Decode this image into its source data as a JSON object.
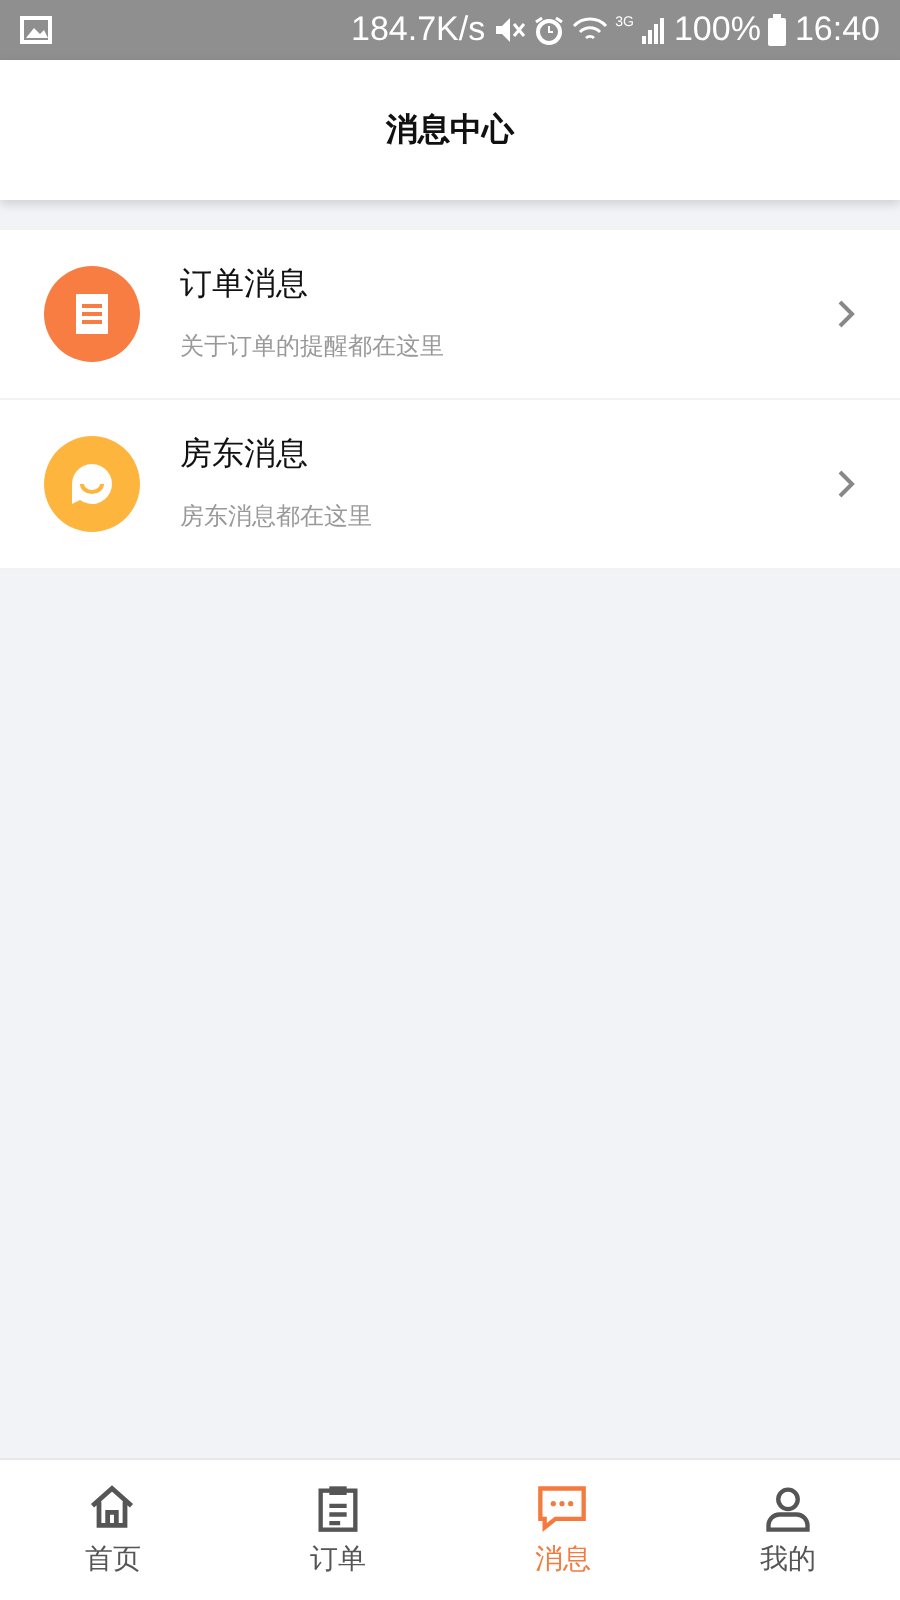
{
  "status_bar": {
    "speed": "184.7K/s",
    "network": "3G",
    "battery": "100%",
    "time": "16:40"
  },
  "header": {
    "title": "消息中心"
  },
  "messages": [
    {
      "kind": "order",
      "title": "订单消息",
      "subtitle": "关于订单的提醒都在这里",
      "color": "#f77d43"
    },
    {
      "kind": "landlord",
      "title": "房东消息",
      "subtitle": "房东消息都在这里",
      "color": "#fdb53e"
    }
  ],
  "tabs": [
    {
      "kind": "home",
      "label": "首页",
      "selected": false
    },
    {
      "kind": "order",
      "label": "订单",
      "selected": false
    },
    {
      "kind": "message",
      "label": "消息",
      "selected": true
    },
    {
      "kind": "profile",
      "label": "我的",
      "selected": false
    }
  ]
}
